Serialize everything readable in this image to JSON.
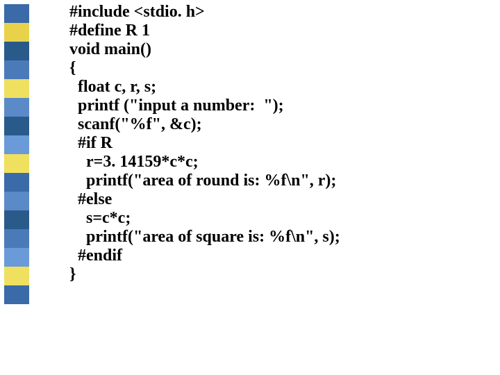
{
  "bullet_colors": [
    "#3a6aa8",
    "#e8d24a",
    "#2a5a8a",
    "#4a7ab8",
    "#f0e060",
    "#5a8ac8",
    "#2a5a8a",
    "#6a9ad8",
    "#f0e060",
    "#3a6aa8",
    "#5a8ac8",
    "#2a5a8a",
    "#4a7ab8",
    "#6a9ad8",
    "#f0e060",
    "#3a6aa8"
  ],
  "code_lines": [
    "#include <stdio. h>",
    "#define R 1",
    "void main()",
    "{",
    "  float c, r, s;",
    "  printf (\"input a number:  \");",
    "  scanf(\"%f\", &c);",
    "  #if R",
    "    r=3. 14159*c*c;",
    "    printf(\"area of round is: %f\\n\", r);",
    "  #else",
    "    s=c*c;",
    "    printf(\"area of square is: %f\\n\", s);",
    "  #endif",
    "}"
  ]
}
